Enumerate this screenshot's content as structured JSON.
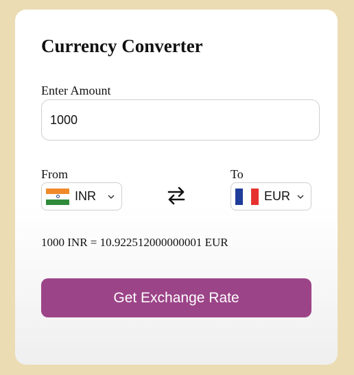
{
  "title": "Currency Converter",
  "amount": {
    "label": "Enter Amount",
    "value": "1000"
  },
  "from": {
    "label": "From",
    "currency": "INR",
    "flag": "india-flag"
  },
  "to": {
    "label": "To",
    "currency": "EUR",
    "flag": "france-flag"
  },
  "swap_icon": "swap-arrows-icon",
  "result": "1000 INR = 10.922512000000001 EUR",
  "button": {
    "label": "Get Exchange Rate"
  },
  "colors": {
    "background": "#ecdcb3",
    "accent": "#9c4488",
    "card": "#ffffff"
  }
}
